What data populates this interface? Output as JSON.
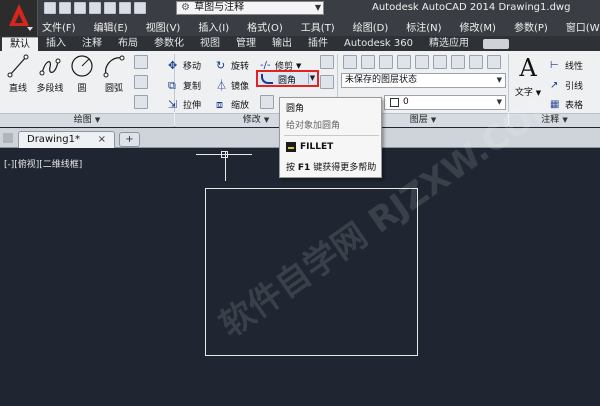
{
  "titlebar": {
    "workspace": "草图与注释",
    "title": "Autodesk AutoCAD 2014    Drawing1.dwg"
  },
  "menubar": {
    "items": [
      "文件(F)",
      "编辑(E)",
      "视图(V)",
      "插入(I)",
      "格式(O)",
      "工具(T)",
      "绘图(D)",
      "标注(N)",
      "修改(M)",
      "参数(P)",
      "窗口(W)"
    ]
  },
  "ribbon_tabs": {
    "items": [
      "默认",
      "插入",
      "注释",
      "布局",
      "参数化",
      "视图",
      "管理",
      "输出",
      "插件",
      "Autodesk 360",
      "精选应用"
    ],
    "active": "默认"
  },
  "draw_panel": {
    "line": "直线",
    "polyline": "多段线",
    "circle": "圆",
    "arc": "圆弧",
    "title": "绘图"
  },
  "modify_panel": {
    "move": "移动",
    "rotate": "旋转",
    "trim": "修剪",
    "copy": "复制",
    "mirror": "镜像",
    "fillet": "圆角",
    "stretch": "拉伸",
    "scale": "缩放",
    "title": "修改"
  },
  "layer_panel": {
    "state": "未保存的图层状态",
    "current": "0",
    "title": "图层"
  },
  "annotation_panel": {
    "text": "文字",
    "linear": "线性",
    "leader": "引线",
    "table": "表格",
    "title": "注释"
  },
  "tooltip": {
    "title": "圆角",
    "desc": "给对象加圆角",
    "command": "FILLET",
    "help_prefix": "按",
    "help_key": "F1",
    "help_suffix": "键获得更多帮助"
  },
  "document": {
    "tab": "Drawing1*",
    "view_label": "[-][俯视][二维线框]"
  },
  "watermark": "软件自学网 RJZXW.COM"
}
